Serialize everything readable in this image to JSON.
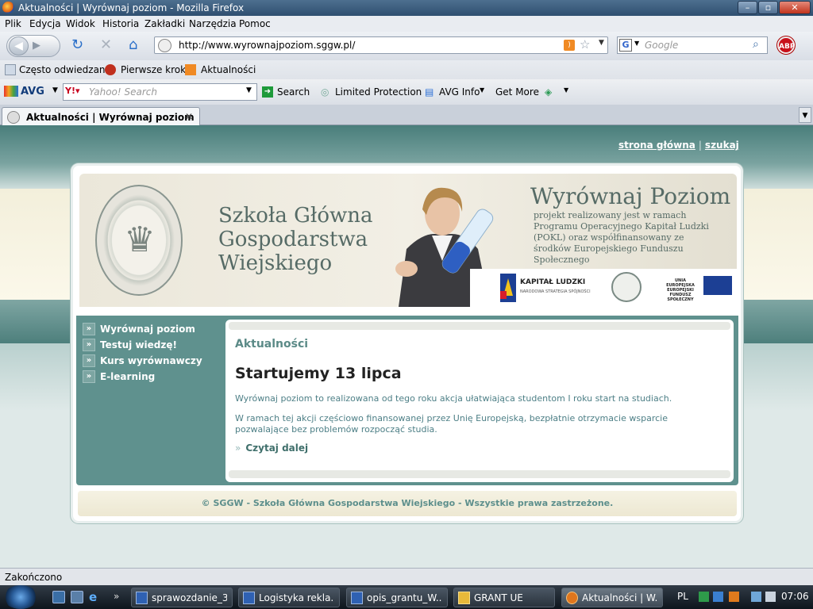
{
  "window": {
    "title": "Aktualności | Wyrównaj poziom - Mozilla Firefox"
  },
  "menu": [
    "Plik",
    "Edycja",
    "Widok",
    "Historia",
    "Zakładki",
    "Narzędzia",
    "Pomoc"
  ],
  "nav": {
    "url": "http://www.wyrownajpoziom.sggw.pl/",
    "search_placeholder": "Google"
  },
  "bookmarks": [
    "Często odwiedzane",
    "Pierwsze kroki",
    "Aktualności"
  ],
  "avg": {
    "logo": "AVG",
    "yahoo_placeholder": "Yahoo! Search",
    "search": "Search",
    "protection": "Limited Protection",
    "info": "AVG Info",
    "more": "Get More"
  },
  "tab": {
    "title": "Aktualności | Wyrównaj poziom"
  },
  "page": {
    "toplinks": {
      "home": "strona główna",
      "sep": "|",
      "search": "szukaj"
    },
    "university": "Szkoła Główna Gospodarstwa Wiejskiego",
    "project_title": "Wyrównaj Poziom",
    "project_desc": "projekt realizowany jest w ramach Programu Operacyjnego Kapitał Ludzki (POKL) oraz współfinansowany ze środków Europejskiego Funduszu Społecznego",
    "logos": {
      "kapital": "KAPITAŁ LUDZKI",
      "kapital_sub": "NARODOWA STRATEGIA SPÓJNOŚCI",
      "ue": "UNIA EUROPEJSKA EUROPEJSKI FUNDUSZ SPOŁECZNY"
    },
    "sidenav": [
      "Wyrównaj poziom",
      "Testuj wiedzę!",
      "Kurs wyrównawczy",
      "E-learning"
    ],
    "section_title": "Aktualności",
    "article_title": "Startujemy 13 lipca",
    "p1": "Wyrównaj poziom to realizowana od tego roku akcja ułatwiająca studentom I roku start na studiach.",
    "p2": "W ramach tej akcji częściowo finansowanej przez Unię Europejską, bezpłatnie otrzymacie wsparcie pozwalające bez problemów rozpocząć studia.",
    "readmore": "Czytaj dalej",
    "footer": "© SGGW - Szkoła Główna Gospodarstwa Wiejskiego - Wszystkie prawa zastrzeżone."
  },
  "status": "Zakończono",
  "taskbar": {
    "tasks": [
      "sprawozdanie_3...",
      "Logistyka rekla...",
      "opis_grantu_W...",
      "GRANT UE",
      "Aktualności | W..."
    ],
    "lang": "PL",
    "clock": "07:06"
  },
  "colors": {
    "teal": "#5f918e",
    "link": "#5b8a87",
    "cream": "#f3efdb"
  }
}
